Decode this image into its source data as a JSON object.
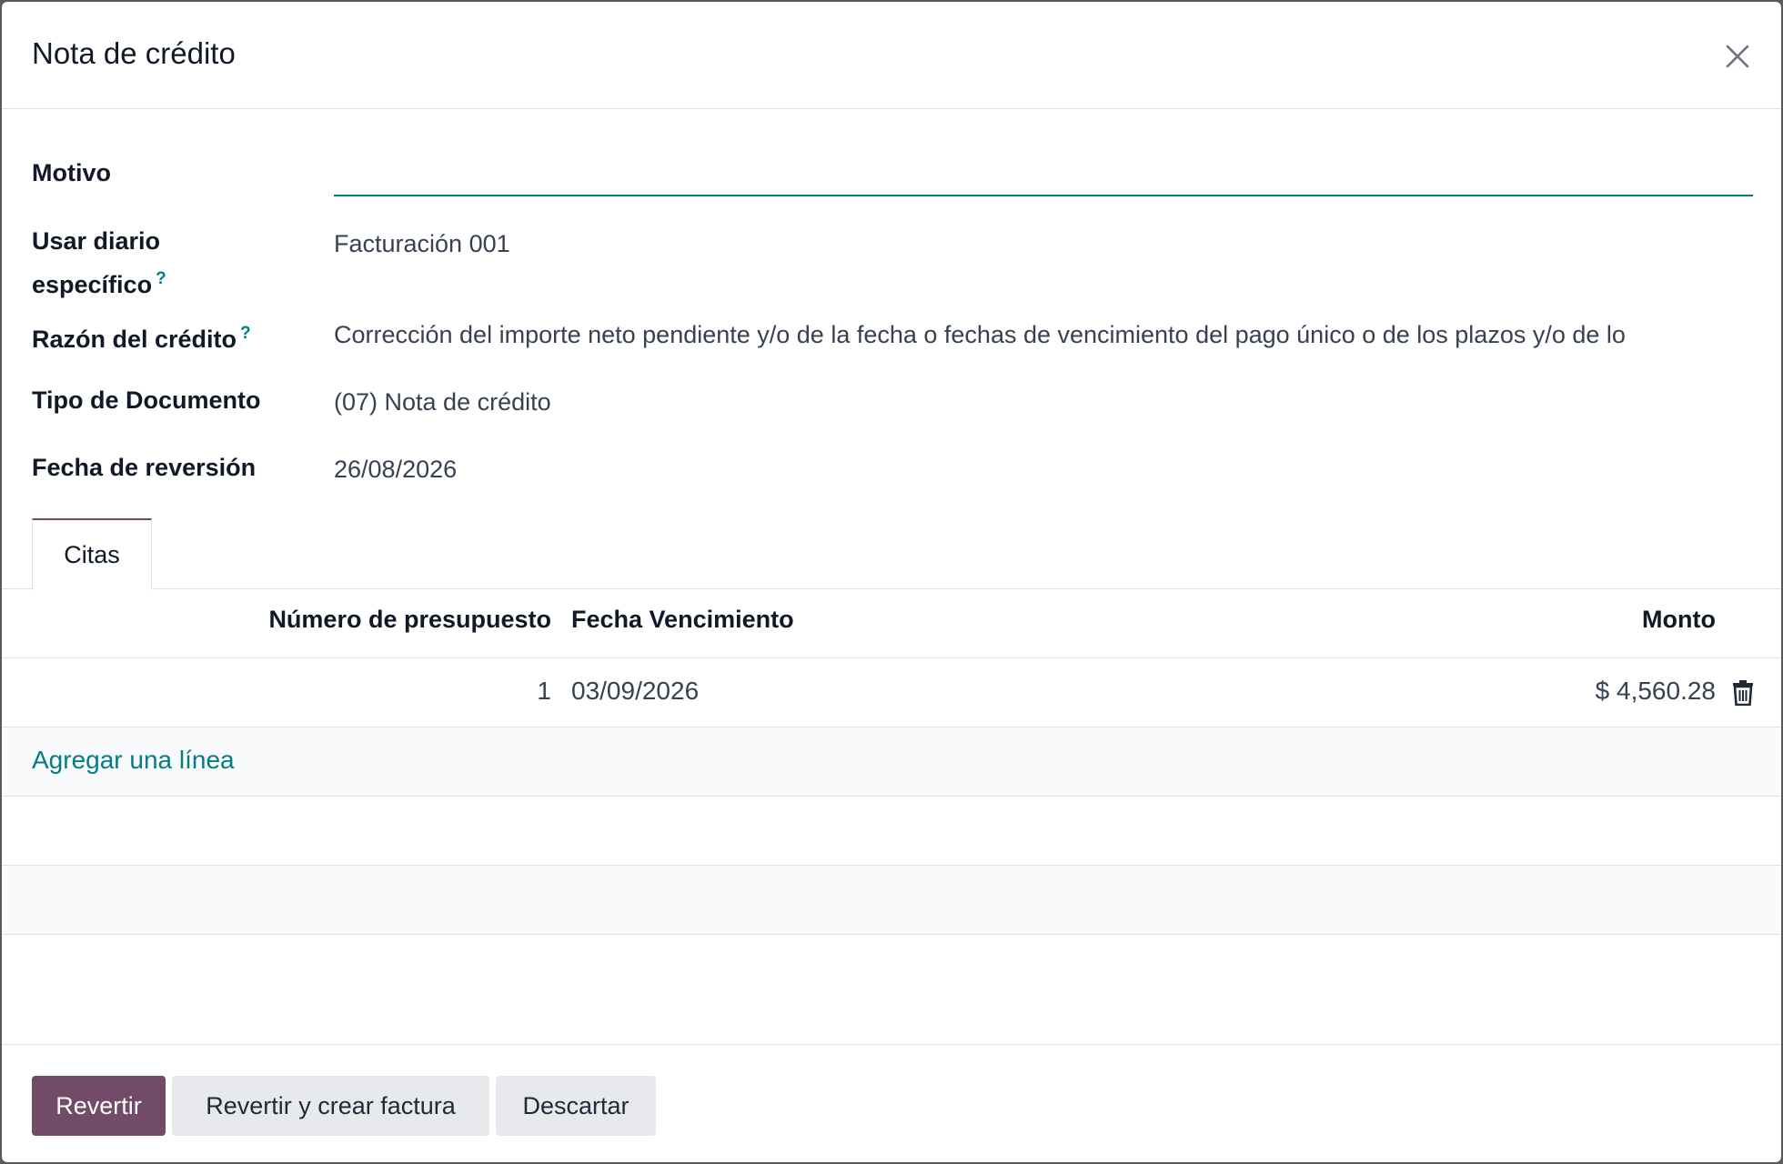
{
  "dialog": {
    "title": "Nota de crédito"
  },
  "form": {
    "motivo_label": "Motivo",
    "motivo_value": "",
    "journal_label_line1": "Usar diario",
    "journal_label_line2": "específico",
    "journal_value": "Facturación 001",
    "reason_label": "Razón del crédito",
    "reason_value": "Corrección del importe neto pendiente y/o de la fecha o fechas de vencimiento del pago único o de los plazos y/o de lo",
    "doc_type_label": "Tipo de Documento",
    "doc_type_value": "(07) Nota de crédito",
    "reversal_date_label": "Fecha de reversión",
    "reversal_date_value": "26/08/2026",
    "help_mark": "?"
  },
  "tabs": [
    {
      "label": "Citas",
      "active": true
    }
  ],
  "table": {
    "columns": [
      "Número de presupuesto",
      "Fecha Vencimiento",
      "Monto"
    ],
    "rows": [
      {
        "number": "1",
        "due_date": "03/09/2026",
        "amount": "$ 4,560.28"
      }
    ],
    "add_line_label": "Agregar una línea"
  },
  "footer": {
    "revert_label": "Revertir",
    "revert_create_label": "Revertir y crear factura",
    "discard_label": "Descartar"
  },
  "colors": {
    "primary": "#714b67",
    "accent": "#017e84",
    "secondary_button": "#e7e9ed"
  },
  "icons": [
    "close-icon",
    "trash-icon"
  ]
}
